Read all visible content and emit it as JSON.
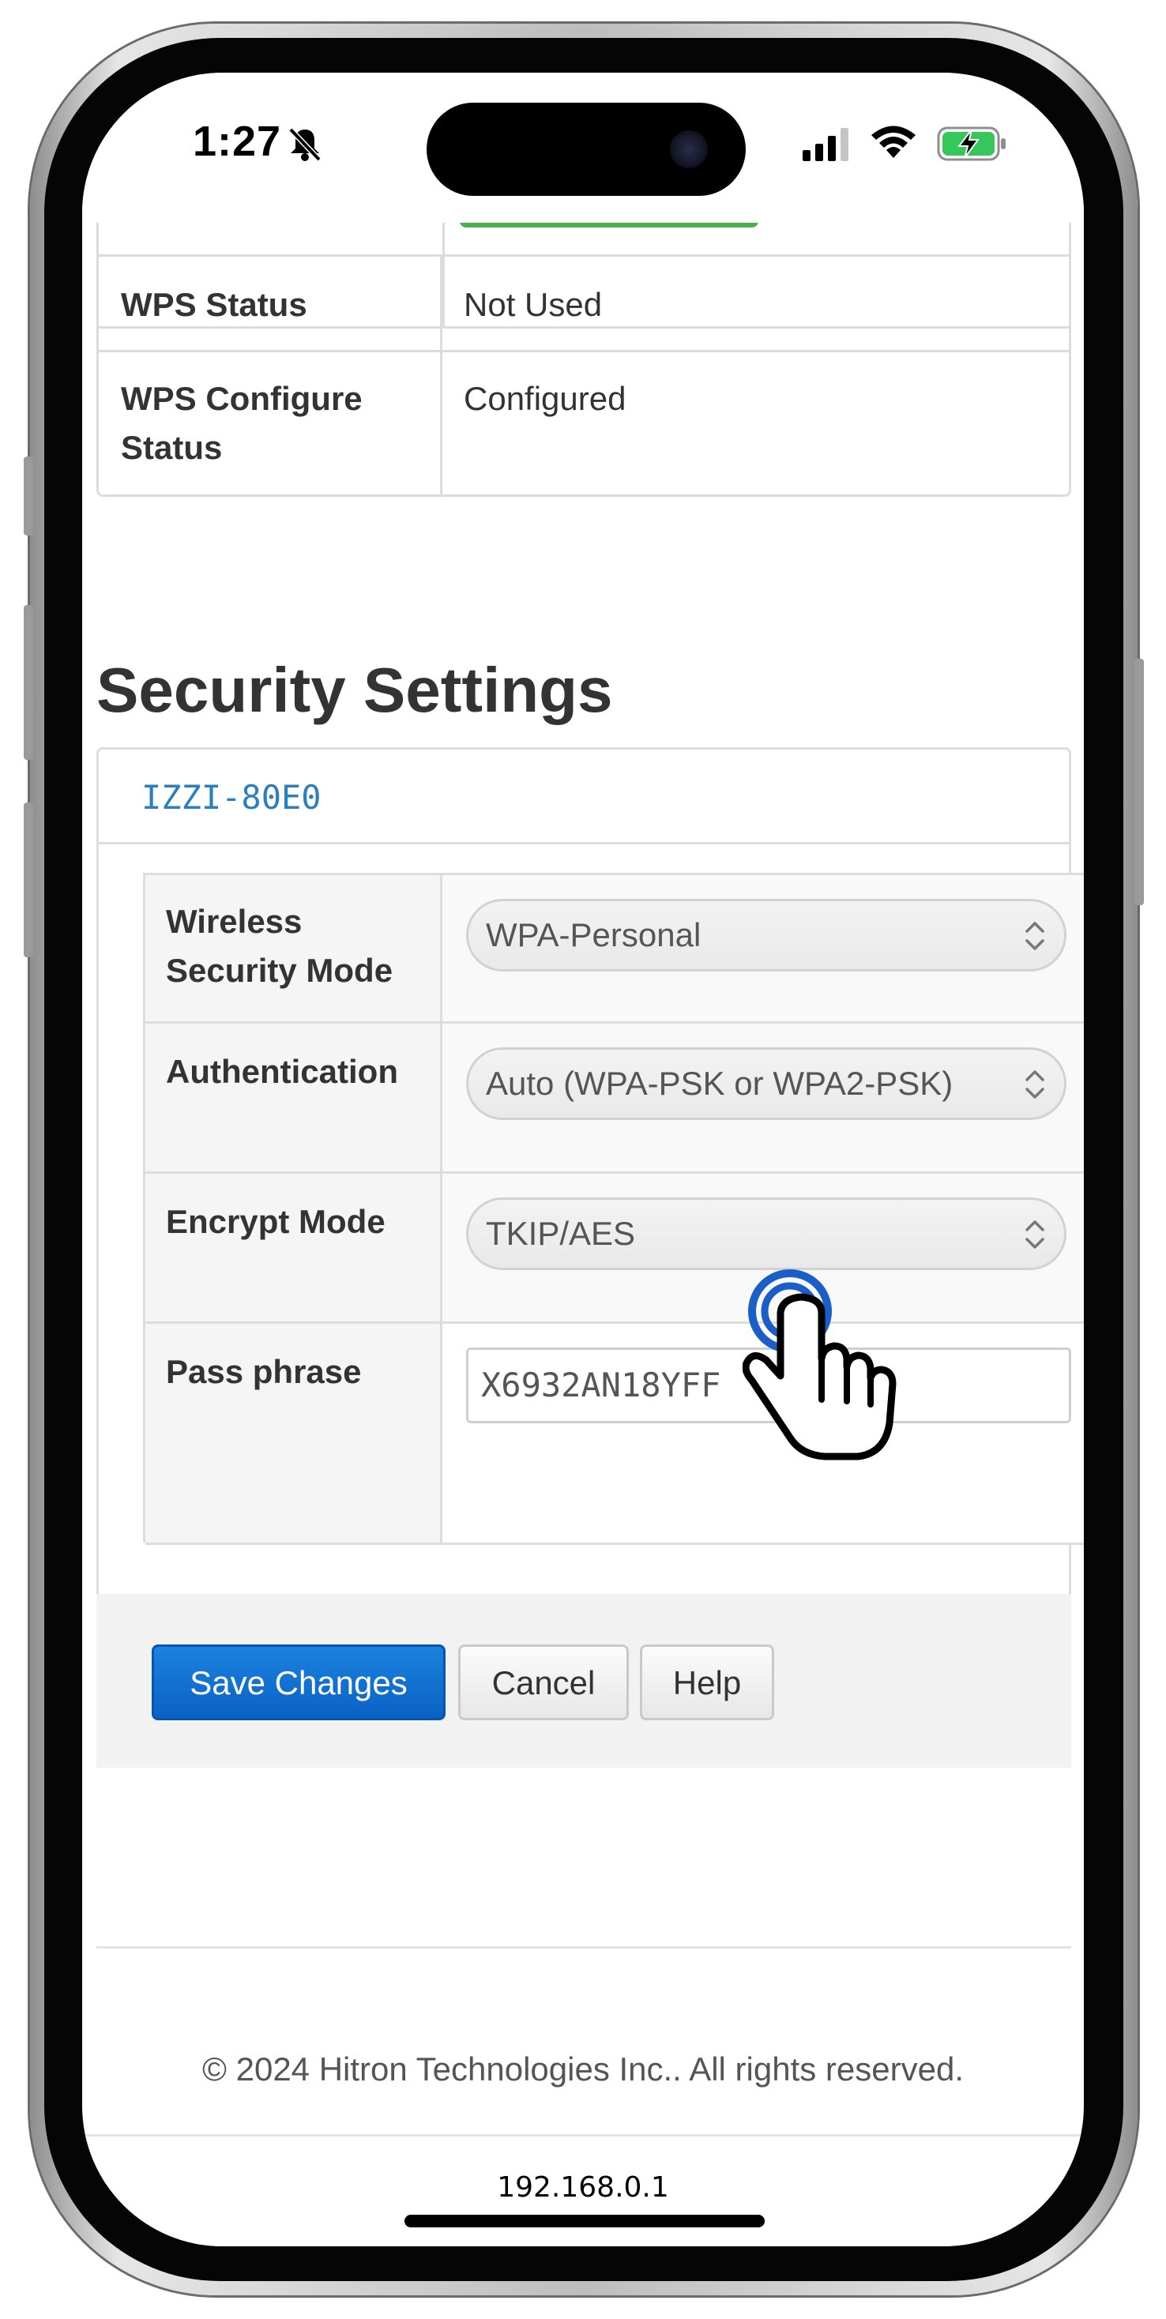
{
  "status_bar": {
    "time": "1:27",
    "icons": [
      "bell-slash-icon",
      "cellular-signal-icon",
      "wifi-icon",
      "battery-charging-icon"
    ],
    "battery_color": "#34c759"
  },
  "wps_table": {
    "rows": [
      {
        "label": "WPS Status",
        "value": "Not Used"
      },
      {
        "label": "WPS Configure Status",
        "value": "Configured"
      }
    ],
    "progress_color": "#4cae4c"
  },
  "security": {
    "title": "Security Settings",
    "ssid": "IZZI-80E0",
    "rows": {
      "mode": {
        "label": "Wireless Security Mode",
        "value": "WPA-Personal"
      },
      "auth": {
        "label": "Authentication",
        "value": "Auto (WPA-PSK or WPA2-PSK)"
      },
      "encrypt": {
        "label": "Encrypt Mode",
        "value": "TKIP/AES"
      },
      "pass": {
        "label": "Pass phrase",
        "value": "X6932AN18YFF"
      }
    }
  },
  "actions": {
    "save": "Save Changes",
    "cancel": "Cancel",
    "help": "Help"
  },
  "footer": {
    "copyright": "© 2024 Hitron Technologies Inc.. All rights reserved.",
    "url": "192.168.0.1"
  },
  "colors": {
    "accent": "#0a62c4",
    "ssid_link": "#2a7fbf",
    "tap_indicator": "#1a5fc8"
  }
}
